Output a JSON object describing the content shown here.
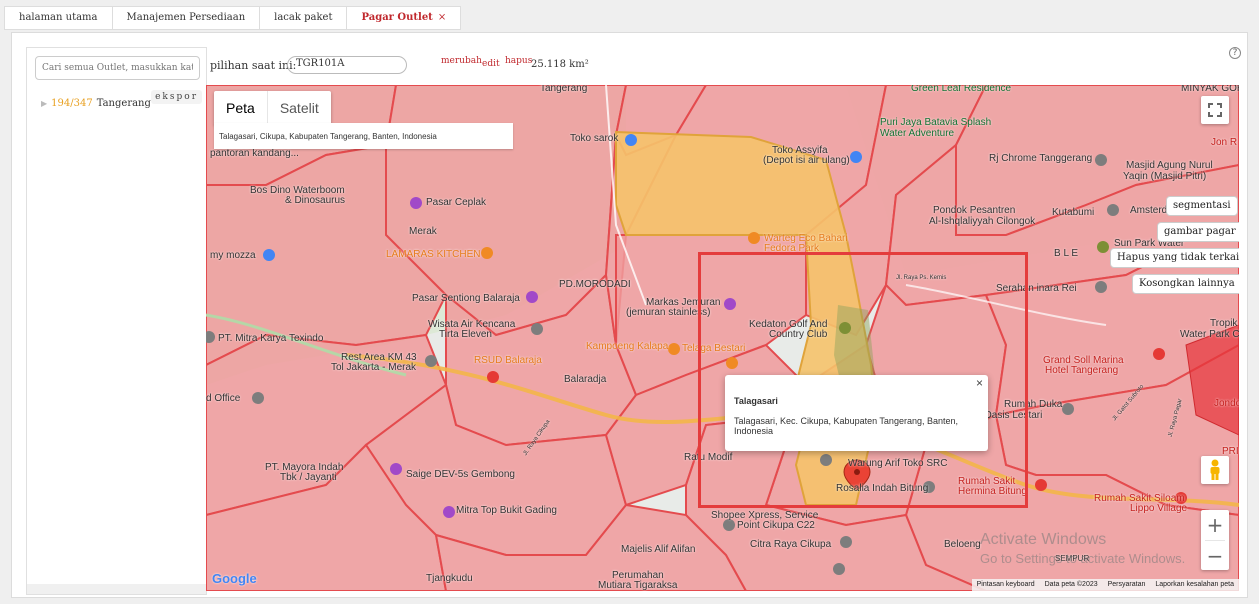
{
  "tabs": [
    {
      "label": "halaman utama"
    },
    {
      "label": "Manajemen Persediaan"
    },
    {
      "label": "lacak paket"
    },
    {
      "label": "Pagar Outlet",
      "close": "×"
    }
  ],
  "sidebar": {
    "search_placeholder": "Cari semua Outlet, masukkan kata kunci",
    "export_label": "ekspor",
    "tree": [
      {
        "count": "194/347",
        "name": "Tangerang"
      }
    ]
  },
  "topinfo": {
    "current_label": "pilihan saat ini:",
    "current_value": "TGR101A",
    "change": "merubah",
    "edit": "edit",
    "delete": "hapus",
    "area": "25.118 km²",
    "help": "?"
  },
  "map": {
    "type_map": "Peta",
    "type_satellite": "Satelit",
    "address": "Talagasari, Cikupa, Kabupaten Tangerang, Banten, Indonesia",
    "buttons": {
      "segmentasi": "segmentasi",
      "gambar_pagar": "gambar pagar",
      "hapus": "Hapus yang tidak terkait",
      "kosongkan": "Kosongkan lainnya"
    },
    "info": {
      "title": "Talagasari",
      "address": "Talagasari, Kec. Cikupa, Kabupaten Tangerang, Banten, Indonesia",
      "close": "×"
    },
    "zoom_in": "+",
    "zoom_out": "−",
    "google": "Google",
    "footer": [
      "Pintasan keyboard",
      "Data peta ©2023",
      "Persyaratan",
      "Laporkan kesalahan peta"
    ],
    "watermark_1": "Activate Windows",
    "watermark_2": "Go to Settings to activate Windows.",
    "pois": {
      "p1": "Tangerang",
      "p2": "Green Leaf Residence",
      "p3": "MINYAK GORENG",
      "p4": "Toko sarok",
      "p5": "Puri Jaya Batavia Splash",
      "p6": "Water Adventure",
      "p7": "Toko Assyifa",
      "p8": "(Depot isi air ulang)",
      "p9": "Jon R",
      "p10": "pantoran kandang...",
      "p11": "Rj Chrome Tanggerang",
      "p12": "Masjid Agung Nurul",
      "p13": "Yaqin (Masjid Pitri)",
      "p14": "Bos Dino Waterboom",
      "p15": "& Dinosaurus",
      "p16": "Pasar Ceplak",
      "p17": "Pondok Pesantren",
      "p18": "Al-Ishqlaliyyah Cilongok",
      "p19": "Kutabumi",
      "p20": "Amsterdam",
      "p21": "Merak",
      "p22": "Warteg Eco Bahari",
      "p23": "Fedora Park",
      "p24": "Sun Park Water",
      "p25": "LAMARAS KITCHEN",
      "p26": "my mozza",
      "p27": "B L E",
      "p28": "PD.MORODADI",
      "p29": "Jl. Raya Ps. Kemis",
      "p30": "Serahan inara Rei",
      "p31": "Pasar Sentiong Balaraja",
      "p32": "Markas Jemuran",
      "p33": "(jemuran stainless)",
      "p34": "Wisata Air Kencana",
      "p35": "Tirta Eleven",
      "p36": "Kedaton Golf And",
      "p37": "Country Club",
      "p38": "Tropik",
      "p39": "Water Park Cimo",
      "p40": "PT. Mitra Karya Texindo",
      "p41": "Kampoeng Kalapa",
      "p42": "Telaga Bestari",
      "p43": "Rest Area KM 43",
      "p44": "Tol Jakarta - Merak",
      "p45": "RSUD Balaraja",
      "p46": "Grand Soll Marina",
      "p47": "Hotel Tangerang",
      "p48": "Balaradja",
      "p49": "d Office",
      "p50": "Rumah Duka",
      "p51": "Oasis Lestari",
      "p52": "Jl. Gatot Subroto",
      "p53": "Jl. Raya Pagar",
      "p54": "Jl. Raya Cikupa",
      "p55": "Ratu Modif",
      "p56": "Jondo",
      "p57": "PT. Mayora Indah",
      "p58": "Tbk / Jayanti",
      "p59": "Saige DEV-5s Gembong",
      "p60": "Warung Arif Toko SRC",
      "p61": "PRI",
      "p62": "Rosalia Indah Bitung",
      "p63": "Rumah Sakit",
      "p64": "Hermina Bitung",
      "p65": "Rumah Sakit Siloam",
      "p66": "Lippo Village",
      "p67": "Mitra Top Bukit Gading",
      "p68": "Shopee Xpress, Service",
      "p69": "Point Cikupa C22",
      "p70": "Majelis Alif Alifan",
      "p71": "Citra Raya Cikupa",
      "p72": "Beloeng",
      "p73": "SEMPUR",
      "p74": "Tjangkudu",
      "p75": "Perumahan",
      "p76": "Mutiara Tigaraksa"
    }
  }
}
